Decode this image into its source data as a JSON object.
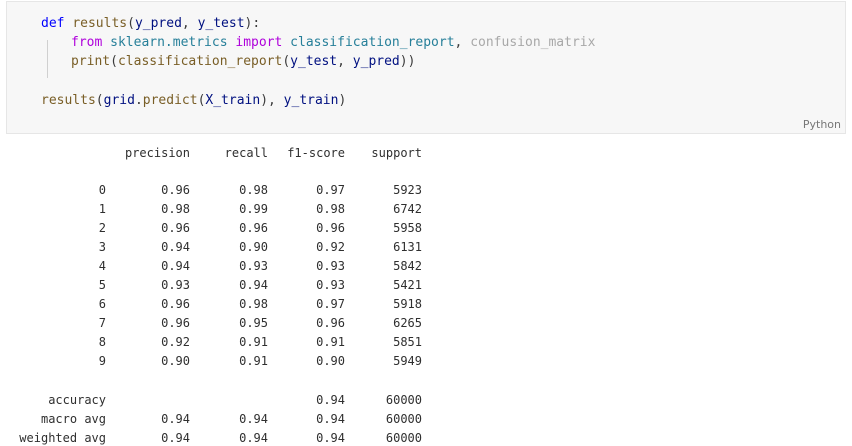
{
  "code": {
    "line1": {
      "def": "def",
      "name": "results",
      "open": "(",
      "p1": "y_pred",
      "comma": ", ",
      "p2": "y_test",
      "close": "):"
    },
    "line2": {
      "from": "from",
      "mod": "sklearn.metrics",
      "import": "import",
      "n1": "classification_report",
      "comma": ", ",
      "n2": "confusion_matrix"
    },
    "line3": {
      "print": "print",
      "open": "(",
      "call": "classification_report",
      "open2": "(",
      "a1": "y_test",
      "comma": ", ",
      "a2": "y_pred",
      "close": "))"
    },
    "line4": {
      "fn": "results",
      "open": "(",
      "obj": "grid",
      "dot": ".",
      "method": "predict",
      "open2": "(",
      "a1": "X_train",
      "close1": ")",
      "comma": ", ",
      "a2": "y_train",
      "close2": ")"
    },
    "language": "Python"
  },
  "report": {
    "headers": [
      "precision",
      "recall",
      "f1-score",
      "support"
    ],
    "rows": [
      {
        "label": "0",
        "precision": "0.96",
        "recall": "0.98",
        "f1": "0.97",
        "support": "5923"
      },
      {
        "label": "1",
        "precision": "0.98",
        "recall": "0.99",
        "f1": "0.98",
        "support": "6742"
      },
      {
        "label": "2",
        "precision": "0.96",
        "recall": "0.96",
        "f1": "0.96",
        "support": "5958"
      },
      {
        "label": "3",
        "precision": "0.94",
        "recall": "0.90",
        "f1": "0.92",
        "support": "6131"
      },
      {
        "label": "4",
        "precision": "0.94",
        "recall": "0.93",
        "f1": "0.93",
        "support": "5842"
      },
      {
        "label": "5",
        "precision": "0.93",
        "recall": "0.94",
        "f1": "0.93",
        "support": "5421"
      },
      {
        "label": "6",
        "precision": "0.96",
        "recall": "0.98",
        "f1": "0.97",
        "support": "5918"
      },
      {
        "label": "7",
        "precision": "0.96",
        "recall": "0.95",
        "f1": "0.96",
        "support": "6265"
      },
      {
        "label": "8",
        "precision": "0.92",
        "recall": "0.91",
        "f1": "0.91",
        "support": "5851"
      },
      {
        "label": "9",
        "precision": "0.90",
        "recall": "0.91",
        "f1": "0.90",
        "support": "5949"
      }
    ],
    "summary": [
      {
        "label": "accuracy",
        "precision": "",
        "recall": "",
        "f1": "0.94",
        "support": "60000"
      },
      {
        "label": "macro avg",
        "precision": "0.94",
        "recall": "0.94",
        "f1": "0.94",
        "support": "60000"
      },
      {
        "label": "weighted avg",
        "precision": "0.94",
        "recall": "0.94",
        "f1": "0.94",
        "support": "60000"
      }
    ]
  }
}
